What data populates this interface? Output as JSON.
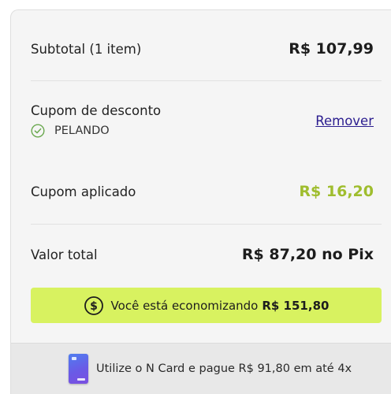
{
  "summary": {
    "subtotal_label": "Subtotal (1 item)",
    "subtotal_value": "R$ 107,99",
    "coupon_label": "Cupom de desconto",
    "coupon_code": "PELANDO",
    "remove_label": "Remover",
    "coupon_applied_label": "Cupom aplicado",
    "coupon_applied_value": "R$ 16,20",
    "total_label": "Valor total",
    "total_value": "R$ 87,20 no Pix"
  },
  "savings": {
    "text": "Você está economizando",
    "amount": "R$ 151,80",
    "icon": "dollar-coin-icon"
  },
  "footer": {
    "text": "Utilize o N Card e pague R$ 91,80 em até 4x",
    "icon": "n-card-icon"
  },
  "colors": {
    "accent_green": "#9fbd2e",
    "savings_bg": "#d8f260",
    "link": "#2b1d8f"
  }
}
